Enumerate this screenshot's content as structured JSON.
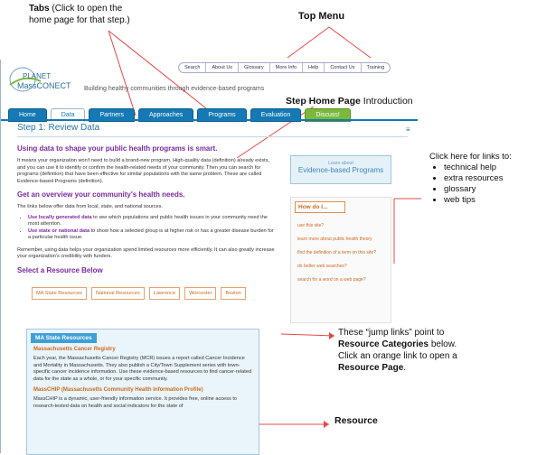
{
  "annotations": {
    "tabs_label_bold": "Tabs",
    "tabs_label_rest": " (Click to open the",
    "tabs_label_line2": "home page for that step.)",
    "top_menu_label": "Top Menu",
    "step_home_bold": "Step Home Page",
    "step_home_rest": " Introduction",
    "click_here": "Click here for links to:",
    "click_items": [
      "technical help",
      "extra resources",
      "glossary",
      "web tips"
    ],
    "jump_line1": "These “jump links” point to",
    "jump_line2_bold": "Resource Categories",
    "jump_line2_rest": " below.",
    "jump_line3": "Click an orange link to open a",
    "jump_line4_bold": "Resource Page",
    "jump_line4_rest": ".",
    "resource_label": "Resource"
  },
  "brand": {
    "planet": "PLANET",
    "massconect": "MassCONECT",
    "tagline": "Building healthy communities through evidence-based programs"
  },
  "top_menu": [
    "Search",
    "About Us",
    "Glossary",
    "More Info",
    "Help",
    "Contact Us",
    "Training"
  ],
  "tabs": [
    "Home",
    "Data",
    "Partners",
    "Approaches",
    "Programs",
    "Evaluation",
    "Discuss!"
  ],
  "content": {
    "step_title": "Step 1: Review Data",
    "h1": "Using data to shape your public health programs is smart.",
    "p1": "It means your organization won't need to build a brand-new program. High-quality data (definition) already exists, and you can use it to identify or confirm the health-related needs of your community. Then you can search for programs (definition) that have been effective for similar populations with the same problem. These are called Evidence-based Programs (definition).",
    "h2": "Get an overview your community's health needs.",
    "p2": "The links below offer data from local, state, and national sources.",
    "bullet1_bold": "Use locally generated data",
    "bullet1_rest": " to see which populations and public health issues in your community need the most attention.",
    "bullet2_bold": "Use state or national data",
    "bullet2_rest": " to show how a selected group is at higher risk or has a greater disease burden for a particular health issue.",
    "p3": "Remember, using data helps your organization spend limited resources more efficiently. It can also greatly increase your organization's credibility with funders.",
    "h3": "Select a Resource Below",
    "jump_links": [
      "MA State Resources",
      "National Resources",
      "Lawrence",
      "Worcester",
      "Boston"
    ],
    "category_head": "MA State Resources",
    "r1_title": "Massachusetts Cancer Registry",
    "r1_body": "Each year, the Massachusetts Cancer Registry (MCR) issues a report called Cancer Incidence and Mortality in Massachusetts. They also publish a City/Town Supplement series with town-specific cancer incidence information. Use these evidence-based resources to find cancer-related data for the state as a whole, or for your specific community.",
    "r2_title": "MassCHIP (Massachusetts Community Health Information Profile)",
    "r2_body": "MassCHIP is a dynamic, user-friendly information service. It provides free, online access to research-tested data on health and social indicators for the state of"
  },
  "sidebar": {
    "learn_small": "Learn about",
    "learn_big": "Evidence-based Programs",
    "howdo_title": "How do I...",
    "howdo_links": [
      "use this site?",
      "learn more about public health theory",
      "find the definition of a term on this site?",
      "do better web searches?",
      "search for a word on a web page?"
    ]
  }
}
